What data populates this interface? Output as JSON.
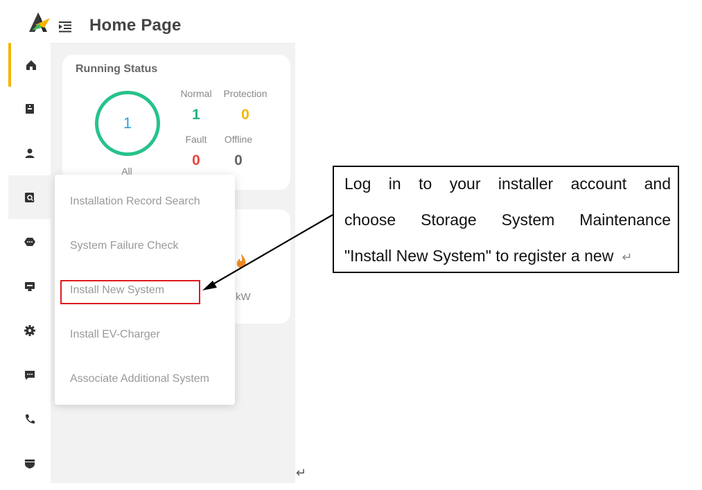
{
  "header": {
    "title": "Home Page"
  },
  "running_status": {
    "title": "Running Status",
    "total": "1",
    "total_label": "All",
    "stats": [
      {
        "label": "Normal",
        "value": "1",
        "color": "#1fb37e"
      },
      {
        "label": "Protection",
        "value": "0",
        "color": "#f0b800"
      },
      {
        "label": "Fault",
        "value": "0",
        "color": "#e8453c"
      },
      {
        "label": "Offline",
        "value": "0",
        "color": "#666666"
      }
    ]
  },
  "power_card": {
    "unit_fragment": "kW"
  },
  "sidebar": {
    "items": [
      {
        "name": "home-icon"
      },
      {
        "name": "storage-icon"
      },
      {
        "name": "user-icon"
      },
      {
        "name": "maintenance-search-icon"
      },
      {
        "name": "device-icon"
      },
      {
        "name": "monitor-icon"
      },
      {
        "name": "gear-icon"
      },
      {
        "name": "message-icon"
      },
      {
        "name": "phone-icon"
      },
      {
        "name": "shield-icon"
      }
    ]
  },
  "dropdown": {
    "items": [
      "Installation Record Search",
      "System Failure Check",
      "Install New System",
      "Install EV-Charger",
      "Associate Additional System"
    ]
  },
  "callout": {
    "lines": [
      "Log in to your installer account and",
      "choose Storage System Maintenance",
      "\"Install New System\" to register a new"
    ],
    "return_mark": "↵"
  },
  "page_return_mark": "↵",
  "colors": {
    "accent": "#f5b400",
    "ring": "#27c28a",
    "highlight": "#e0191f"
  }
}
